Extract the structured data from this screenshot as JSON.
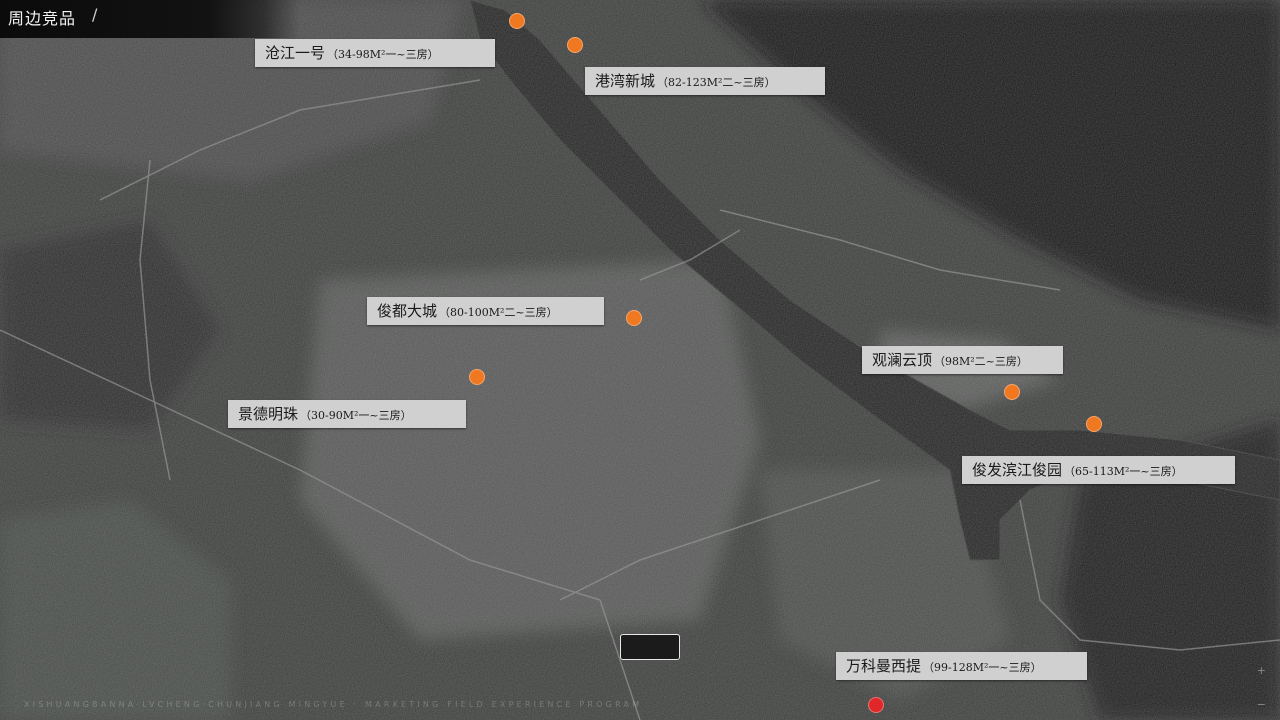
{
  "header": {
    "title": "周边竞品",
    "separator": "/"
  },
  "map": {
    "colors": {
      "marker": "#f07820",
      "marker_alt": "#e02828",
      "label_bg": "#d0d0d0"
    },
    "markers": [
      {
        "name": "沧江一号",
        "spec": "（34-98M²一~三房）"
      },
      {
        "name": "港湾新城",
        "spec": "（82-123M²二~三房）"
      },
      {
        "name": "俊都大城",
        "spec": "（80-100M²二~三房）"
      },
      {
        "name": "景德明珠",
        "spec": "（30-90M²一~三房）"
      },
      {
        "name": "观澜云顶",
        "spec": "（98M²二~三房）"
      },
      {
        "name": "俊发滨江俊园",
        "spec": "（65-113M²一~三房）"
      },
      {
        "name": "万科曼西提",
        "spec": "（99-128M²一~三房）"
      }
    ]
  },
  "footer": {
    "text": "XISHUANGBANNA·LVCHENG·CHUNJIANG MINGYUE · MARKETING FIELD EXPERIENCE PROGRAM"
  },
  "controls": {
    "zoom_in_label": "+",
    "zoom_out_label": "−"
  }
}
